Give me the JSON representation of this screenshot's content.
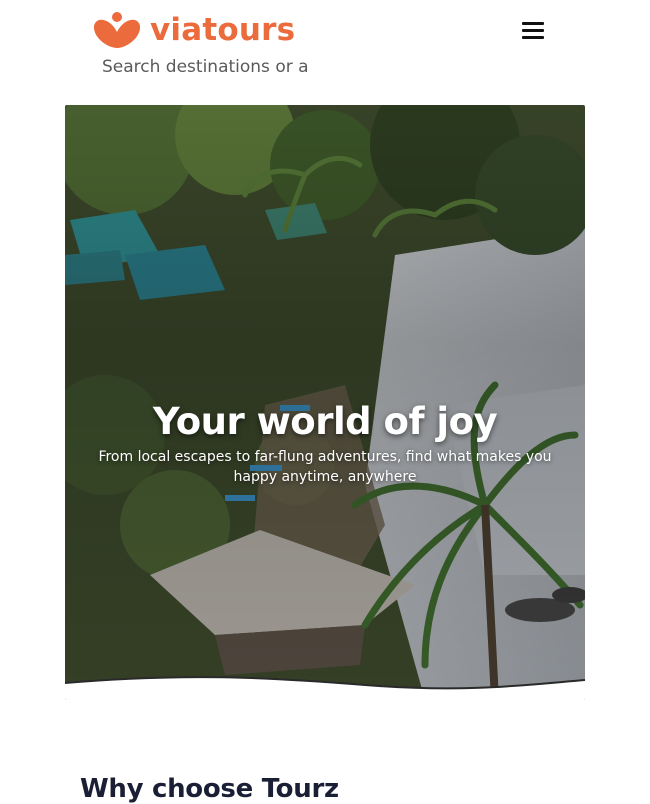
{
  "header": {
    "logo_text": "viatours",
    "brand_color": "#eb6b3c",
    "menu_icon": "hamburger-menu-icon"
  },
  "search": {
    "placeholder": "Search destinations or ac"
  },
  "hero": {
    "title": "Your world of joy",
    "subtitle": "From local escapes to far-flung adventures, find what makes you happy anytime, anywhere"
  },
  "section": {
    "title": "Why choose Tourz"
  }
}
